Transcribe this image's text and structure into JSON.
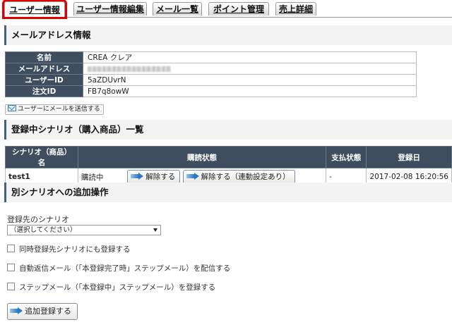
{
  "tabs": [
    {
      "label": "ユーザー情報",
      "active": true
    },
    {
      "label": "ユーザー情報編集",
      "active": false
    },
    {
      "label": "メール一覧",
      "active": false
    },
    {
      "label": "ポイント管理",
      "active": false
    },
    {
      "label": "売上詳細",
      "active": false
    }
  ],
  "mail_section": {
    "title": "メールアドレス情報",
    "rows": [
      {
        "key": "名前",
        "value": "CREA クレア"
      },
      {
        "key": "メールアドレス",
        "value": ""
      },
      {
        "key": "ユーザーID",
        "value": "5aZDUvrN"
      },
      {
        "key": "注文ID",
        "value": "FB7q8owW"
      }
    ],
    "send_mail_button": "ユーザーにメールを送信する"
  },
  "scenario_section": {
    "title": "登録中シナリオ（購入商品）一覧",
    "headers": [
      "シナリオ（商品）名",
      "購読状態",
      "支払状態",
      "登録日"
    ],
    "rows": [
      {
        "name": "test1",
        "status": "購読中",
        "cancel_button": "解除する",
        "cancel_linked_button": "解除する（連動設定あり）",
        "payment": "-",
        "date": "2017-02-08 16:20:56"
      }
    ]
  },
  "add_section": {
    "title": "別シナリオへの追加操作",
    "target_label": "登録先のシナリオ",
    "select_value": "（選択してください）",
    "checkboxes": [
      "同時登録先シナリオにも登録する",
      "自動返信メール（「本登録完了時」ステップメール）を配信する",
      "ステップメール（「本登録中」ステップメール）を登録する"
    ],
    "add_button": "追加登録する"
  },
  "colors": {
    "header_bg": "#3e4e5e",
    "active_tab_outline": "#e00000",
    "arrow": "#2f79c2"
  },
  "icons": {
    "mail": "envelope-icon",
    "arrow": "arrow-right-icon",
    "caret": "chevron-down-icon"
  }
}
